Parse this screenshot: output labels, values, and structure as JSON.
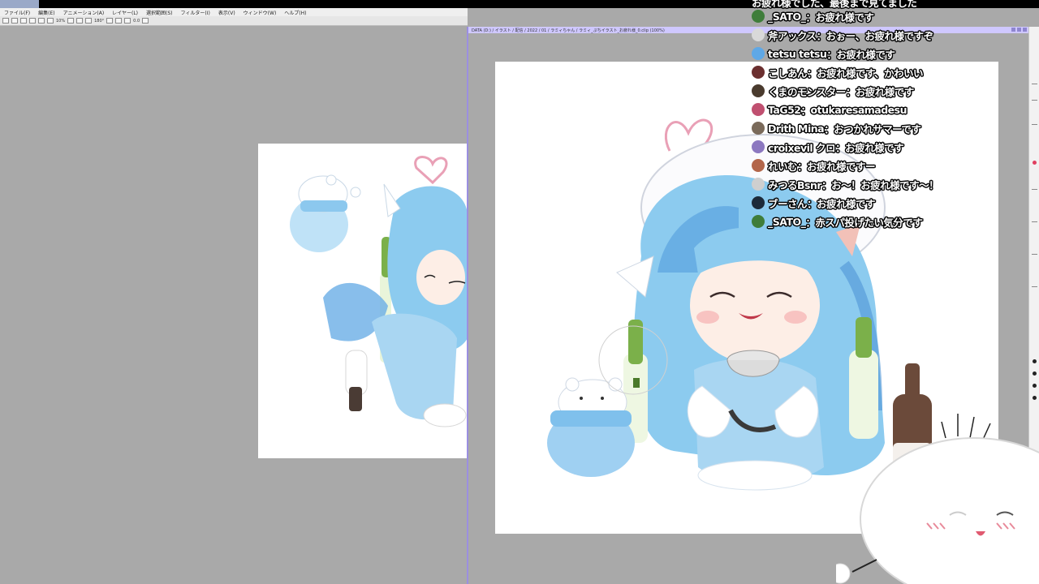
{
  "app": {
    "menu": [
      "ファイル(F)",
      "編集(E)",
      "アニメーション(A)",
      "レイヤー(L)",
      "選択範囲(S)",
      "フィルター(I)",
      "表示(V)",
      "ウィンドウ(W)",
      "ヘルプ(H)"
    ],
    "toolbar_text": [
      "10%",
      "180°",
      "0.0"
    ],
    "right_window_title": "DATA (D:) / イラスト / 配信 / 2022 / 01 / ラミィちゃん / ラミィ_ぷちイラスト_お疲れ様_0.clip (100%)"
  },
  "chat": {
    "partial_top_message": "お疲れ様でした、最後まで見てました",
    "messages": [
      {
        "author": "_SATO_",
        "text": "お疲れ様です",
        "avatar_color": "#3f7d3a"
      },
      {
        "author": "斧アックス",
        "text": "おぉー、お疲れ様ですぞ",
        "avatar_color": "#d9d9d9"
      },
      {
        "author": "tetsu tetsu",
        "text": "お疲れ様です",
        "avatar_color": "#5fa8e6"
      },
      {
        "author": "こしあん",
        "text": "お疲れ様です、かわいい",
        "avatar_color": "#6b2f2f"
      },
      {
        "author": "くまのモンスター",
        "text": "お疲れ様です",
        "avatar_color": "#4a3b2e"
      },
      {
        "author": "TaG52",
        "text": "otukaresamadesu",
        "avatar_color": "#c05070"
      },
      {
        "author": "Drith Mina",
        "text": "おつかれサマーです",
        "avatar_color": "#7a6a5a"
      },
      {
        "author": "croixevil クロ",
        "text": "お疲れ様です",
        "avatar_color": "#8c78c0"
      },
      {
        "author": "れいむ",
        "text": "お疲れ様ですー",
        "avatar_color": "#b3664a"
      },
      {
        "author": "みつるBsnr",
        "text": "お～！お疲れ様です～！",
        "avatar_color": "#cfcfcf"
      },
      {
        "author": "ブーさん",
        "text": "お疲れ様です",
        "avatar_color": "#1c2a3a"
      },
      {
        "author": "_SATO_",
        "text": "赤スパ投げたい気分です",
        "avatar_color": "#3f7d3a"
      }
    ]
  },
  "colors": {
    "workspace": "#a9a9a9",
    "window_accent": "#9b8fe0",
    "hair": "#8ccbef",
    "hair_dark": "#4f95d6",
    "bottle_green": "#7bb04a",
    "bottle_brown": "#6b4a3a"
  }
}
